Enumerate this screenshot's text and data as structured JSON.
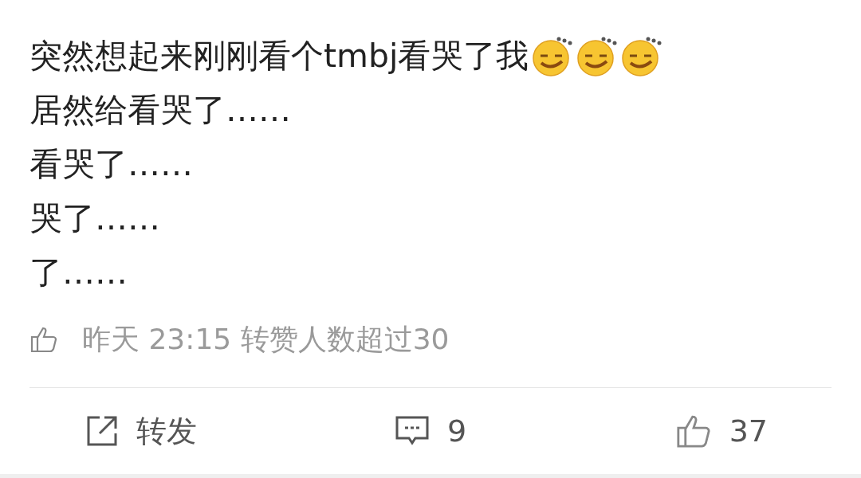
{
  "post": {
    "lines": [
      {
        "text": "突然想起来刚刚看个tmbj看哭了我",
        "kind": "with-emoji"
      },
      {
        "text": "居然给看哭了……",
        "kind": "plain"
      },
      {
        "text": "看哭了……",
        "kind": "plain"
      },
      {
        "text": "哭了……",
        "kind": "plain"
      },
      {
        "text": "了……",
        "kind": "plain"
      }
    ],
    "meta": "昨天 23:15 转赞人数超过30"
  },
  "actions": [
    {
      "kind": "repost",
      "label": "转发"
    },
    {
      "kind": "comment",
      "label": "9"
    },
    {
      "kind": "like",
      "label": "37"
    }
  ]
}
